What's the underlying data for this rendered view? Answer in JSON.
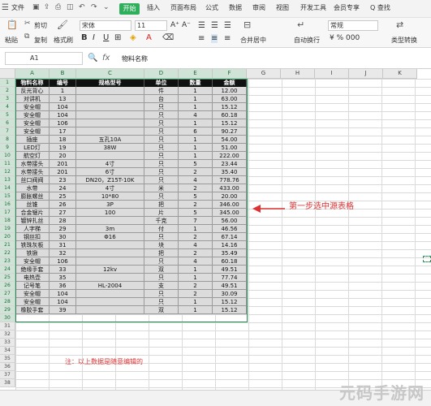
{
  "menu": {
    "items": [
      "文件",
      "开始",
      "插入",
      "页面布局",
      "公式",
      "数据",
      "审阅",
      "视图",
      "开发工具",
      "会员专享"
    ],
    "search": "Q 查找"
  },
  "toolbar": {
    "paste": "粘贴",
    "cut": "剪切",
    "copy": "复制",
    "format_painter": "格式刷",
    "font": "宋体",
    "size": "11",
    "merge": "合并居中",
    "wrap": "自动换行",
    "number_format": "常规",
    "type_convert": "类型转换"
  },
  "formula": {
    "cell_ref": "A1",
    "fx": "fx",
    "content": "物料名称"
  },
  "columns": [
    "A",
    "B",
    "C",
    "D",
    "E",
    "F",
    "G",
    "H",
    "I",
    "J",
    "K"
  ],
  "rows": [
    "1",
    "2",
    "3",
    "4",
    "5",
    "6",
    "7",
    "8",
    "9",
    "10",
    "11",
    "12",
    "13",
    "14",
    "15",
    "16",
    "17",
    "18",
    "19",
    "20",
    "21",
    "22",
    "23",
    "24",
    "25",
    "26",
    "27",
    "28",
    "29",
    "30",
    "31",
    "32",
    "33",
    "34",
    "35",
    "36",
    "37",
    "38"
  ],
  "table": {
    "headers": [
      "物料名称",
      "编号",
      "规格型号",
      "单位",
      "数量",
      "金额"
    ],
    "rows": [
      [
        "反光背心",
        "1",
        "",
        "件",
        "1",
        "12.00"
      ],
      [
        "对讲机",
        "13",
        "",
        "台",
        "1",
        "63.00"
      ],
      [
        "安全帽",
        "104",
        "",
        "只",
        "1",
        "15.12"
      ],
      [
        "安全帽",
        "104",
        "",
        "只",
        "4",
        "60.18"
      ],
      [
        "安全帽",
        "106",
        "",
        "只",
        "1",
        "15.12"
      ],
      [
        "安全帽",
        "17",
        "",
        "只",
        "6",
        "90.27"
      ],
      [
        "插座",
        "18",
        "五孔10A",
        "只",
        "1",
        "54.00"
      ],
      [
        "LED灯",
        "19",
        "38W",
        "只",
        "1",
        "51.00"
      ],
      [
        "航空灯",
        "20",
        "",
        "只",
        "1",
        "222.00"
      ],
      [
        "水带接头",
        "201",
        "4寸",
        "只",
        "5",
        "23.44"
      ],
      [
        "水带接头",
        "201",
        "6寸",
        "只",
        "2",
        "35.40"
      ],
      [
        "丝口阀阀",
        "23",
        "DN20，Z15T-10K",
        "只",
        "4",
        "778.76"
      ],
      [
        "水带",
        "24",
        "4寸",
        "米",
        "2",
        "433.00"
      ],
      [
        "膨胀螺丝",
        "25",
        "10*80",
        "只",
        "5",
        "20.00"
      ],
      [
        "丝锥",
        "26",
        "3P",
        "把",
        "2",
        "346.00"
      ],
      [
        "合金锯片",
        "27",
        "100",
        "片",
        "5",
        "345.00"
      ],
      [
        "镀锌扎丝",
        "28",
        "",
        "千克",
        "7",
        "56.00"
      ],
      [
        "人字梯",
        "29",
        "3m",
        "付",
        "1",
        "46.56"
      ],
      [
        "钢丝扣",
        "30",
        "Φ16",
        "只",
        "2",
        "67.14"
      ],
      [
        "铁珠灰板",
        "31",
        "",
        "块",
        "4",
        "14.16"
      ],
      [
        "铁锹",
        "32",
        "",
        "把",
        "2",
        "35.49"
      ],
      [
        "安全帽",
        "106",
        "",
        "只",
        "4",
        "60.18"
      ],
      [
        "绝缘手套",
        "33",
        "12kv",
        "双",
        "1",
        "49.51"
      ],
      [
        "电热壶",
        "35",
        "",
        "只",
        "1",
        "77.74"
      ],
      [
        "记号笔",
        "36",
        "HL-2004",
        "支",
        "2",
        "49.51"
      ],
      [
        "安全帽",
        "104",
        "",
        "只",
        "2",
        "30.09"
      ],
      [
        "安全帽",
        "104",
        "",
        "只",
        "1",
        "15.12"
      ],
      [
        "橡胶手套",
        "39",
        "",
        "双",
        "1",
        "15.12"
      ]
    ]
  },
  "annotation": "第一步选中源表格",
  "note": "注：以上数据是随意编辑的",
  "watermark": "元码手游网"
}
